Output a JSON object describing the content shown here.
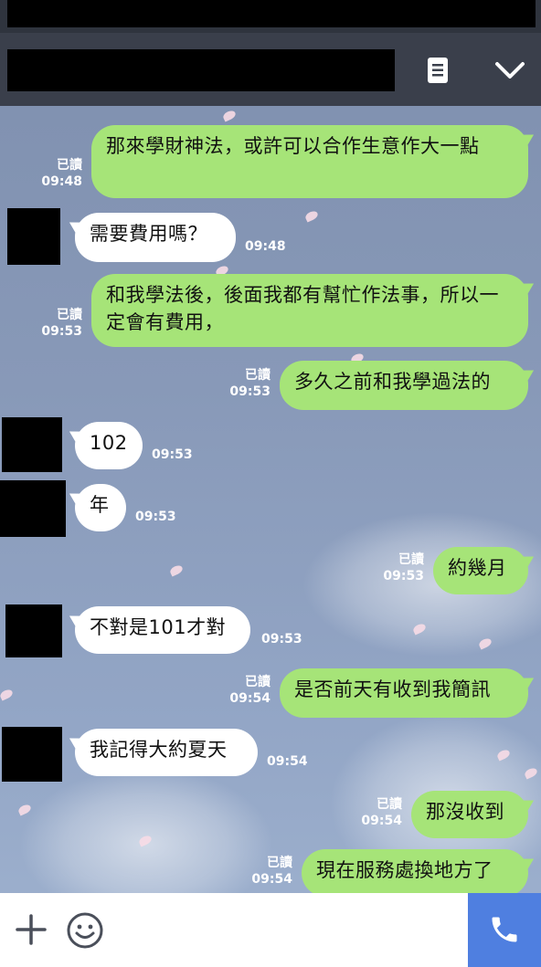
{
  "header": {
    "title": "",
    "menu_icon": "menu-list-icon",
    "collapse_icon": "chevron-down-icon"
  },
  "messages": [
    {
      "dir": "out",
      "text": "那來學財神法，或許可以合作生意作大一點",
      "read": "已讀",
      "time": "09:48"
    },
    {
      "dir": "in",
      "text": "需要費用嗎？",
      "time": "09:48"
    },
    {
      "dir": "out",
      "text": "和我學法後，後面我都有幫忙作法事，所以一定會有費用，",
      "read": "已讀",
      "time": "09:53"
    },
    {
      "dir": "out",
      "text": "多久之前和我學過法的",
      "read": "已讀",
      "time": "09:53"
    },
    {
      "dir": "in",
      "text": "102",
      "time": "09:53"
    },
    {
      "dir": "in",
      "text": "年",
      "time": "09:53"
    },
    {
      "dir": "out",
      "text": "約幾月",
      "read": "已讀",
      "time": "09:53"
    },
    {
      "dir": "in",
      "text": "不對是101才對",
      "time": "09:53"
    },
    {
      "dir": "out",
      "text": "是否前天有收到我簡訊",
      "read": "已讀",
      "time": "09:54"
    },
    {
      "dir": "in",
      "text": "我記得大約夏天",
      "time": "09:54"
    },
    {
      "dir": "out",
      "text": "那沒收到",
      "read": "已讀",
      "time": "09:54"
    },
    {
      "dir": "out",
      "text": "現在服務處換地方了",
      "read": "已讀",
      "time": "09:54"
    }
  ],
  "input_bar": {
    "plus_icon": "plus-icon",
    "emoji_icon": "emoji-icon",
    "call_icon": "phone-icon"
  },
  "colors": {
    "outgoing_bubble": "#a6e478",
    "incoming_bubble": "#ffffff",
    "header": "#3a3f4b",
    "call_button": "#4f7fe0"
  }
}
